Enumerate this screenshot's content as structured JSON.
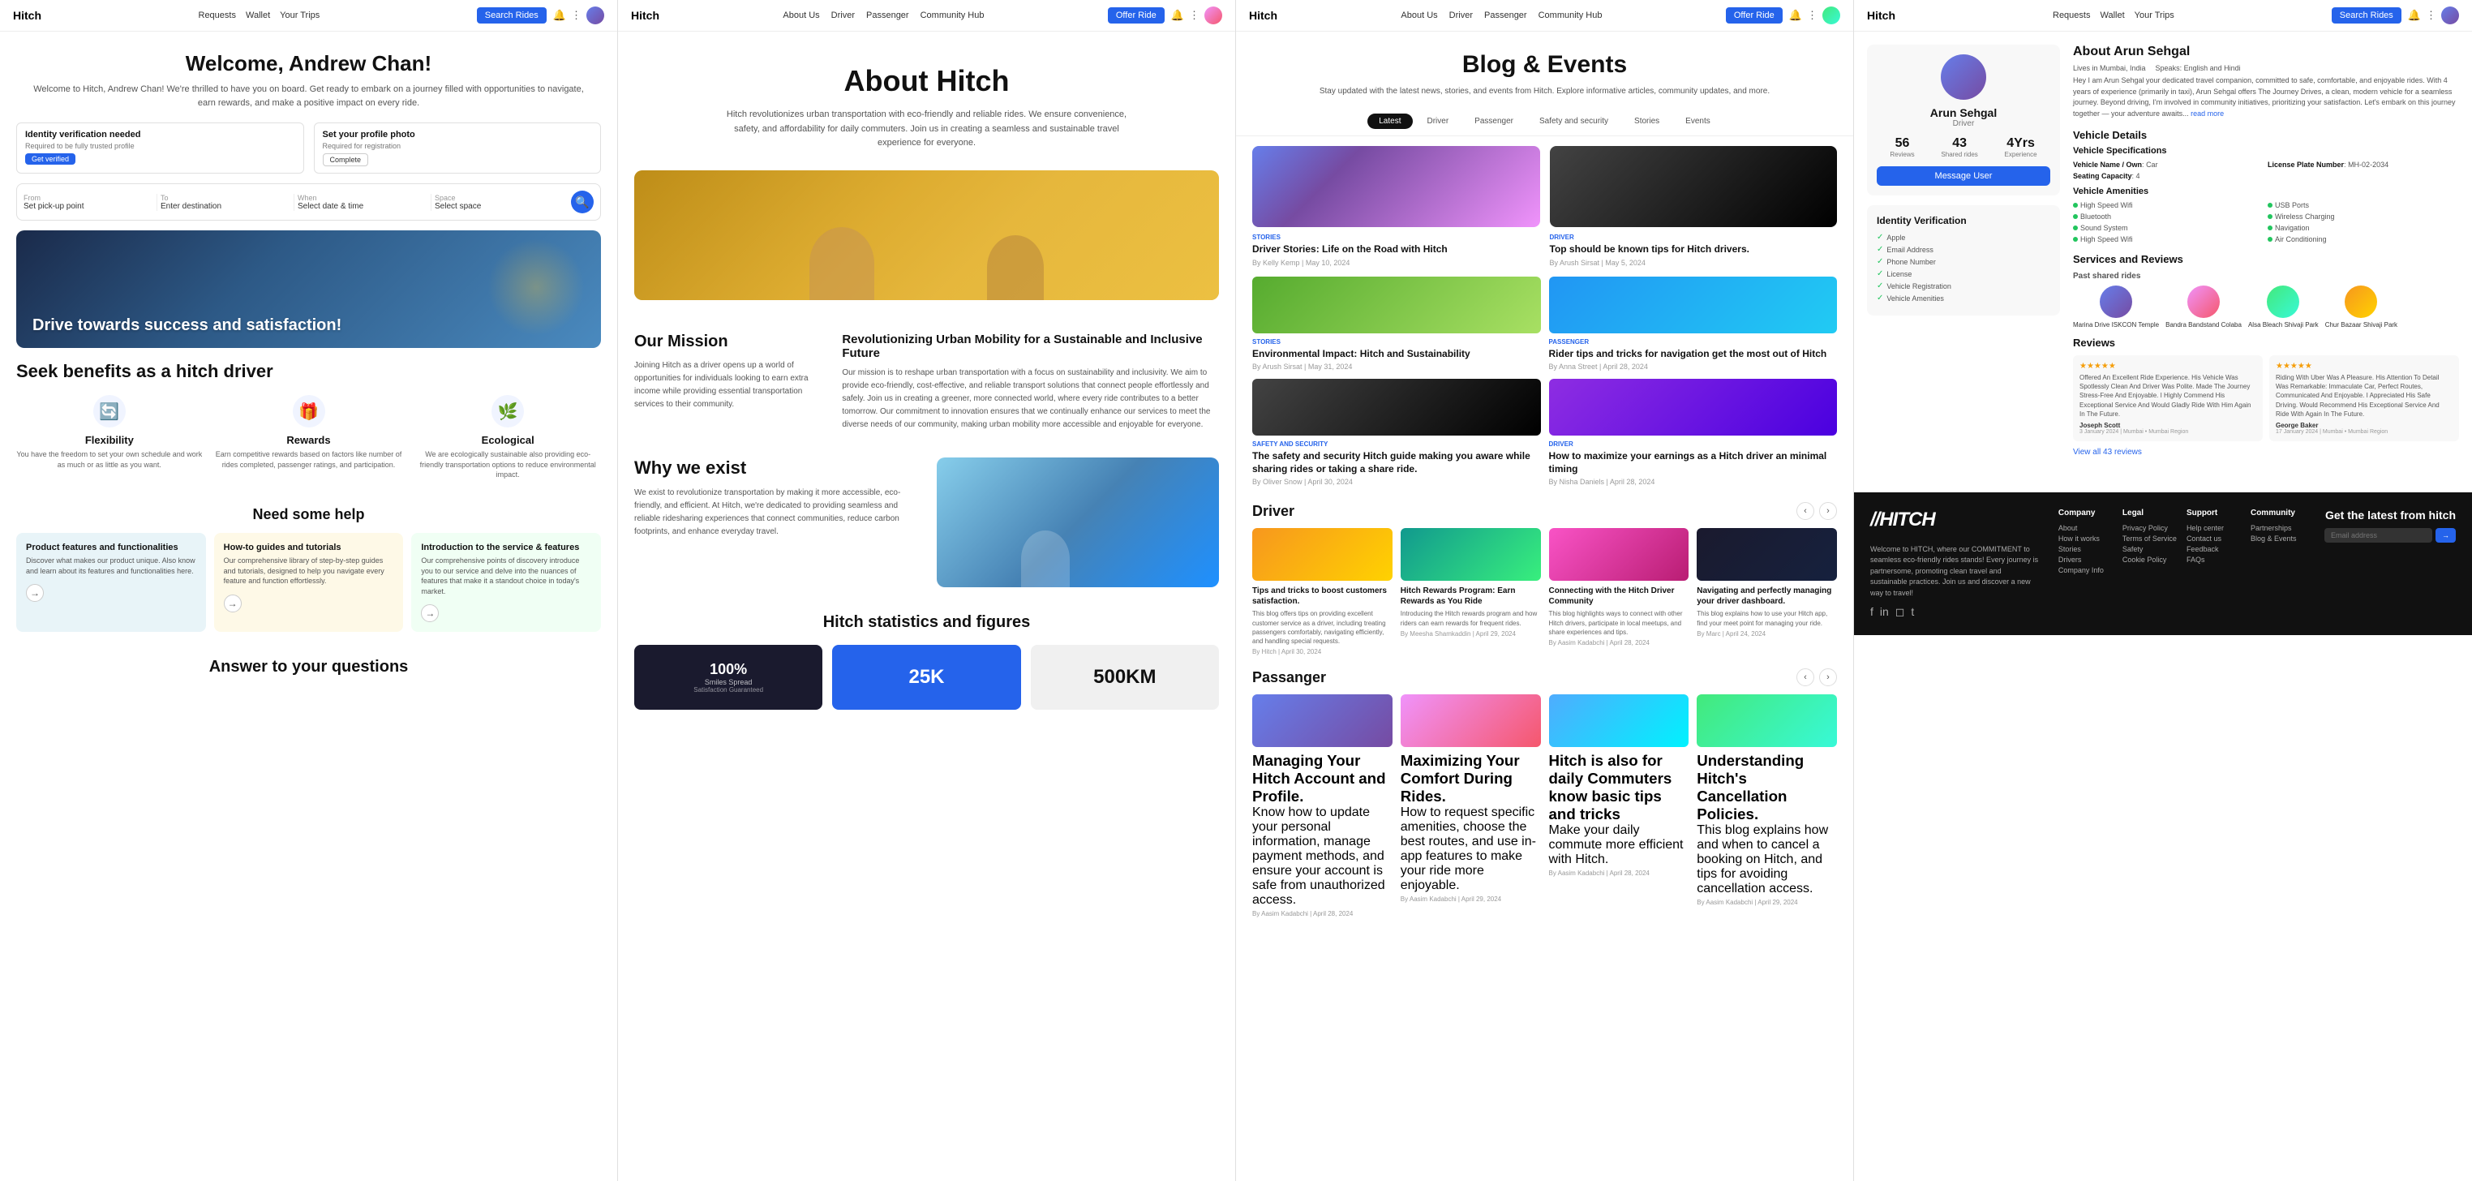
{
  "panels": {
    "panel1": {
      "nav": {
        "logo": "Hitch",
        "links": [
          "Requests",
          "Wallet",
          "Your Trips"
        ],
        "search_btn": "Search Rides",
        "icons": [
          "🔔",
          "⋮"
        ]
      },
      "hero": {
        "title": "Welcome, Andrew Chan!",
        "subtitle": "Welcome to Hitch, Andrew Chan! We're thrilled to have you on board. Get ready to embark on a journey filled with opportunities to navigate, earn rewards, and make a positive impact on every ride."
      },
      "alerts": {
        "identity": {
          "title": "Identity verification needed",
          "sub": "Required to be fully trusted profile",
          "btn": "Get verified"
        },
        "profile": {
          "title": "Set your profile photo",
          "sub": "Required for registration",
          "btn": "Complete"
        }
      },
      "search": {
        "from_label": "From",
        "from_val": "Set pick-up point",
        "to_label": "To",
        "to_val": "Enter destination",
        "when_label": "When",
        "when_val": "Select date & time",
        "space_label": "Space",
        "space_val": "Select space"
      },
      "banner": {
        "text": "Drive towards success and satisfaction!"
      },
      "seek": {
        "title": "Seek benefits as a hitch driver",
        "benefits": [
          {
            "icon": "🔄",
            "title": "Flexibility",
            "desc": "You have the freedom to set your own schedule and work as much or as little as you want."
          },
          {
            "icon": "🎁",
            "title": "Rewards",
            "desc": "Earn competitive rewards based on factors like number of rides completed, passenger ratings, and participation."
          },
          {
            "icon": "🌿",
            "title": "Ecological",
            "desc": "We are ecologically sustainable also providing eco-friendly transportation options to reduce environmental impact."
          }
        ]
      },
      "help": {
        "title": "Need some help",
        "cards": [
          {
            "title": "Product features and functionalities",
            "desc": "Discover what makes our product unique. Also know and learn about its features and functionalities here."
          },
          {
            "title": "How-to guides and tutorials",
            "desc": "Our comprehensive library of step-by-step guides and tutorials, designed to help you navigate every feature and function effortlessly."
          },
          {
            "title": "Introduction to the service & features",
            "desc": "Our comprehensive points of discovery introduce you to our service and delve into the nuances of features that make it a standout choice in today's market."
          }
        ]
      },
      "faq": {
        "title": "Answer to your questions"
      }
    },
    "panel2": {
      "nav": {
        "logo": "Hitch",
        "links": [
          "About Us",
          "Driver",
          "Passenger",
          "Community Hub"
        ],
        "offer_btn": "Offer Ride"
      },
      "hero": {
        "title": "About Hitch",
        "subtitle": "Hitch revolutionizes urban transportation with eco-friendly and reliable rides. We ensure convenience, safety, and affordability for daily commuters. Join us in creating a seamless and sustainable travel experience for everyone."
      },
      "mission": {
        "left_title": "Our Mission",
        "right_title": "Revolutionizing Urban Mobility for a Sustainable and Inclusive Future",
        "left_text": "Joining Hitch as a driver opens up a world of opportunities for individuals looking to earn extra income while providing essential transportation services to their community.",
        "right_text": "Our mission is to reshape urban transportation with a focus on sustainability and inclusivity. We aim to provide eco-friendly, cost-effective, and reliable transport solutions that connect people effortlessly and safely. Join us in creating a greener, more connected world, where every ride contributes to a better tomorrow. Our commitment to innovation ensures that we continually enhance our services to meet the diverse needs of our community, making urban mobility more accessible and enjoyable for everyone."
      },
      "why": {
        "title": "Why we exist",
        "text": "We exist to revolutionize transportation by making it more accessible, eco-friendly, and efficient. At Hitch, we're dedicated to providing seamless and reliable ridesharing experiences that connect communities, reduce carbon footprints, and enhance everyday travel."
      },
      "stats": {
        "title": "Hitch statistics and figures",
        "values": [
          {
            "value": "100%",
            "label": "Smiles Spread",
            "sublabel": "Satisfaction Guaranteed"
          },
          {
            "value": "25K",
            "label": ""
          },
          {
            "value": "500KM",
            "label": ""
          }
        ]
      }
    },
    "panel3": {
      "nav": {
        "logo": "Hitch",
        "links": [
          "About Us",
          "Driver",
          "Passenger",
          "Community Hub"
        ],
        "offer_btn": "Offer Ride"
      },
      "hero": {
        "title": "Blog & Events",
        "subtitle": "Stay updated with the latest news, stories, and events from Hitch. Explore informative articles, community updates, and more."
      },
      "tabs": [
        "Latest",
        "Driver",
        "Passenger",
        "Safety and security",
        "Stories",
        "Events"
      ],
      "featured_articles": [
        {
          "tag": "STORIES",
          "title": "Driver Stories: Life on the Road with Hitch",
          "meta": "By Kelly Kemp | May 10, 2024",
          "img_type": "mountains"
        },
        {
          "tag": "DRIVER",
          "title": "Top should be known tips for Hitch drivers.",
          "meta": "By Arush Sirsat | May 5, 2024"
        }
      ],
      "grid_articles": [
        {
          "tag": "STORIES",
          "title": "Environmental Impact: Hitch and Sustainability",
          "meta": "By Arush Sirsat | May 31, 2024",
          "img": "green"
        },
        {
          "tag": "PASSENGER",
          "title": "Rider tips and tricks for navigation get the most out of Hitch",
          "meta": "By Anna Street | April 28, 2024",
          "img": "blue"
        },
        {
          "tag": "SAFETY AND SECURITY",
          "title": "The safety and security Hitch guide making you aware while sharing rides or taking a share ride.",
          "meta": "By Oliver Snow | April 30, 2024",
          "img": "dark"
        },
        {
          "tag": "DRIVER",
          "title": "How to maximize your earnings as a Hitch driver an minimal timing",
          "meta": "By Nisha Daniels | April 28, 2024",
          "img": "purple"
        }
      ],
      "driver_section": {
        "title": "Driver",
        "cards": [
          {
            "title": "Tips and tricks to boost customers satisfaction.",
            "desc": "This blog offers tips on providing excellent customer service as a driver, including treating passengers comfortably, navigating efficiently, and handling special requests.",
            "meta": "By Hitch | April 30, 2024",
            "img": "yellow"
          },
          {
            "title": "Hitch Rewards Program: Earn Rewards as You Ride",
            "desc": "Introducing the Hitch rewards program and how riders can earn rewards for frequent rides.",
            "meta": "By Meesha Shamkaddin | April 29, 2024",
            "img": "store"
          },
          {
            "title": "Connecting with the Hitch Driver Community",
            "desc": "This blog highlights ways to connect with other Hitch drivers, participate in local meetups, and share experiences and tips.",
            "meta": "By Aasim Kadabchi | April 28, 2024",
            "img": "road"
          },
          {
            "title": "Navigating and perfectly managing your driver dashboard.",
            "desc": "This blog explains how to use your Hitch app, find your meet point for managing your ride.",
            "meta": "By Marc | April 24, 2024",
            "img": "dash"
          }
        ]
      },
      "passenger_section": {
        "title": "Passanger",
        "cards": [
          {
            "title": "Managing Your Hitch Account and Profile.",
            "desc": "Know how to update your personal information, manage payment methods, and ensure your account is safe from unauthorized access.",
            "meta": "By Aasim Kadabchi | April 28, 2024",
            "img": "laptop"
          },
          {
            "title": "Maximizing Your Comfort During Rides.",
            "desc": "How to request specific amenities, choose the best routes, and use in-app features to make your ride more enjoyable.",
            "meta": "By Aasim Kadabchi | April 29, 2024",
            "img": "comfort"
          },
          {
            "title": "Hitch is also for daily Commuters know basic tips and tricks",
            "desc": "Make your daily commute more efficient with Hitch.",
            "meta": "By Aasim Kadabchi | April 28, 2024",
            "img": "sticky"
          },
          {
            "title": "Understanding Hitch's Cancellation Policies.",
            "desc": "This blog explains how and when to cancel a booking on Hitch, and tips for avoiding cancellation access.",
            "meta": "By Aasim Kadabchi | April 29, 2024",
            "img": "woman"
          }
        ]
      }
    },
    "panel4": {
      "nav": {
        "logo": "Hitch",
        "links": [
          "Requests",
          "Wallet",
          "Your Trips"
        ],
        "search_btn": "Search Rides"
      },
      "profile": {
        "name": "Arun Sehgal",
        "role": "Driver",
        "location": "Lives in Mumbai, India",
        "languages": "Speaks: English and Hindi",
        "stats": {
          "reviews": {
            "label": "Reviews",
            "value": "56"
          },
          "shared": {
            "label": "Shared rides",
            "value": "43"
          },
          "experience": {
            "label": "Experience",
            "value": "4Yrs"
          }
        },
        "bio": "Hey I am Arun Sehgal your dedicated travel companion, committed to safe, comfortable, and enjoyable rides. With 4 years of experience (primarily in taxi), Arun Sehgal offers The Journey Drives, a clean, modern vehicle for a seamless journey. Beyond driving, I'm involved in community initiatives, prioritizing your satisfaction. Let's embark on this journey together — your adventure awaits...",
        "message_btn": "Message User",
        "identity": {
          "title": "Identity Verification",
          "items": [
            "Apple",
            "Email Address",
            "Phone Number",
            "License",
            "Vehicle Registration",
            "Vehicle Amenities"
          ]
        }
      },
      "vehicle": {
        "title": "Vehicle Details",
        "specs_title": "Vehicle Specifications",
        "specs": [
          {
            "label": "Vehicle Name / Own",
            "value": "Car"
          },
          {
            "label": "License Plate Number",
            "value": "MH-02-2034"
          },
          {
            "label": "Seating Capacity",
            "value": "4"
          }
        ],
        "amenities_title": "Vehicle Amenities",
        "amenities": [
          "High Speed Wifi",
          "USB Ports",
          "Bluetooth",
          "Wireless Charging",
          "Sound System",
          "Navigation",
          "High Speed Wifi",
          "Air Conditioning"
        ]
      },
      "services": {
        "title": "Services and Reviews",
        "rides_label": "Past shared rides",
        "rides": [
          {
            "name": "Marina Drive ISKCON Temple",
            "color": "#667eea"
          },
          {
            "name": "Bandra Bandstand Colaba",
            "color": "#f093fb"
          },
          {
            "name": "Alsa Bleach Shivaji Park",
            "color": "#43e97b"
          },
          {
            "name": "Chur Bazaar Shivaji Park",
            "color": "#f59e0b"
          }
        ],
        "reviews_title": "Reviews",
        "reviews": [
          {
            "stars": "★★★★★",
            "text": "Offered An Excellent Ride Experience. His Vehicle Was Spotlessly Clean And Driver Was Polite. Made The Journey Stress-Free And Enjoyable. I Highly Commend His Exceptional Service And Would Gladly Ride With Him Again In The Future.",
            "author": "Joseph Scott",
            "date": "3 January 2024 | Mumbai • Mumbai Region"
          },
          {
            "stars": "★★★★★",
            "text": "Riding With Uber Was A Pleasure. His Attention To Detail Was Remarkable: Immaculate Car, Perfect Routes, Communicated And Enjoyable. I Appreciated His Safe Driving. Would Recommend His Exceptional Service And Ride With Again In The Future.",
            "author": "George Baker",
            "date": "17 January 2024 | Mumbai • Mumbai Region"
          }
        ],
        "view_all": "View all 43 reviews"
      },
      "footer": {
        "logo": "//HITCH",
        "tagline": "Welcome to HITCH, where our COMMITMENT to seamless eco-friendly rides stands! Every journey is partnersome, promoting clean travel and sustainable practices. Join us and discover a new way to travel!",
        "columns": [
          {
            "title": "Company",
            "links": [
              "About",
              "How it works",
              "Stories",
              "Drivers",
              "Company Info"
            ]
          },
          {
            "title": "Legal",
            "links": [
              "Privacy Policy",
              "Terms of Service",
              "Safety",
              "Cookie Policy"
            ]
          },
          {
            "title": "Support",
            "links": [
              "Help center",
              "Contact us",
              "Feedback",
              "FAQs"
            ]
          },
          {
            "title": "Community",
            "links": [
              "Partnerships",
              "Blog & Events"
            ]
          }
        ],
        "newsletter_title": "Get the latest from hitch",
        "email_placeholder": "Email address",
        "subscribe_btn": "→",
        "social": [
          "f",
          "in",
          "◻",
          "t"
        ]
      }
    }
  }
}
